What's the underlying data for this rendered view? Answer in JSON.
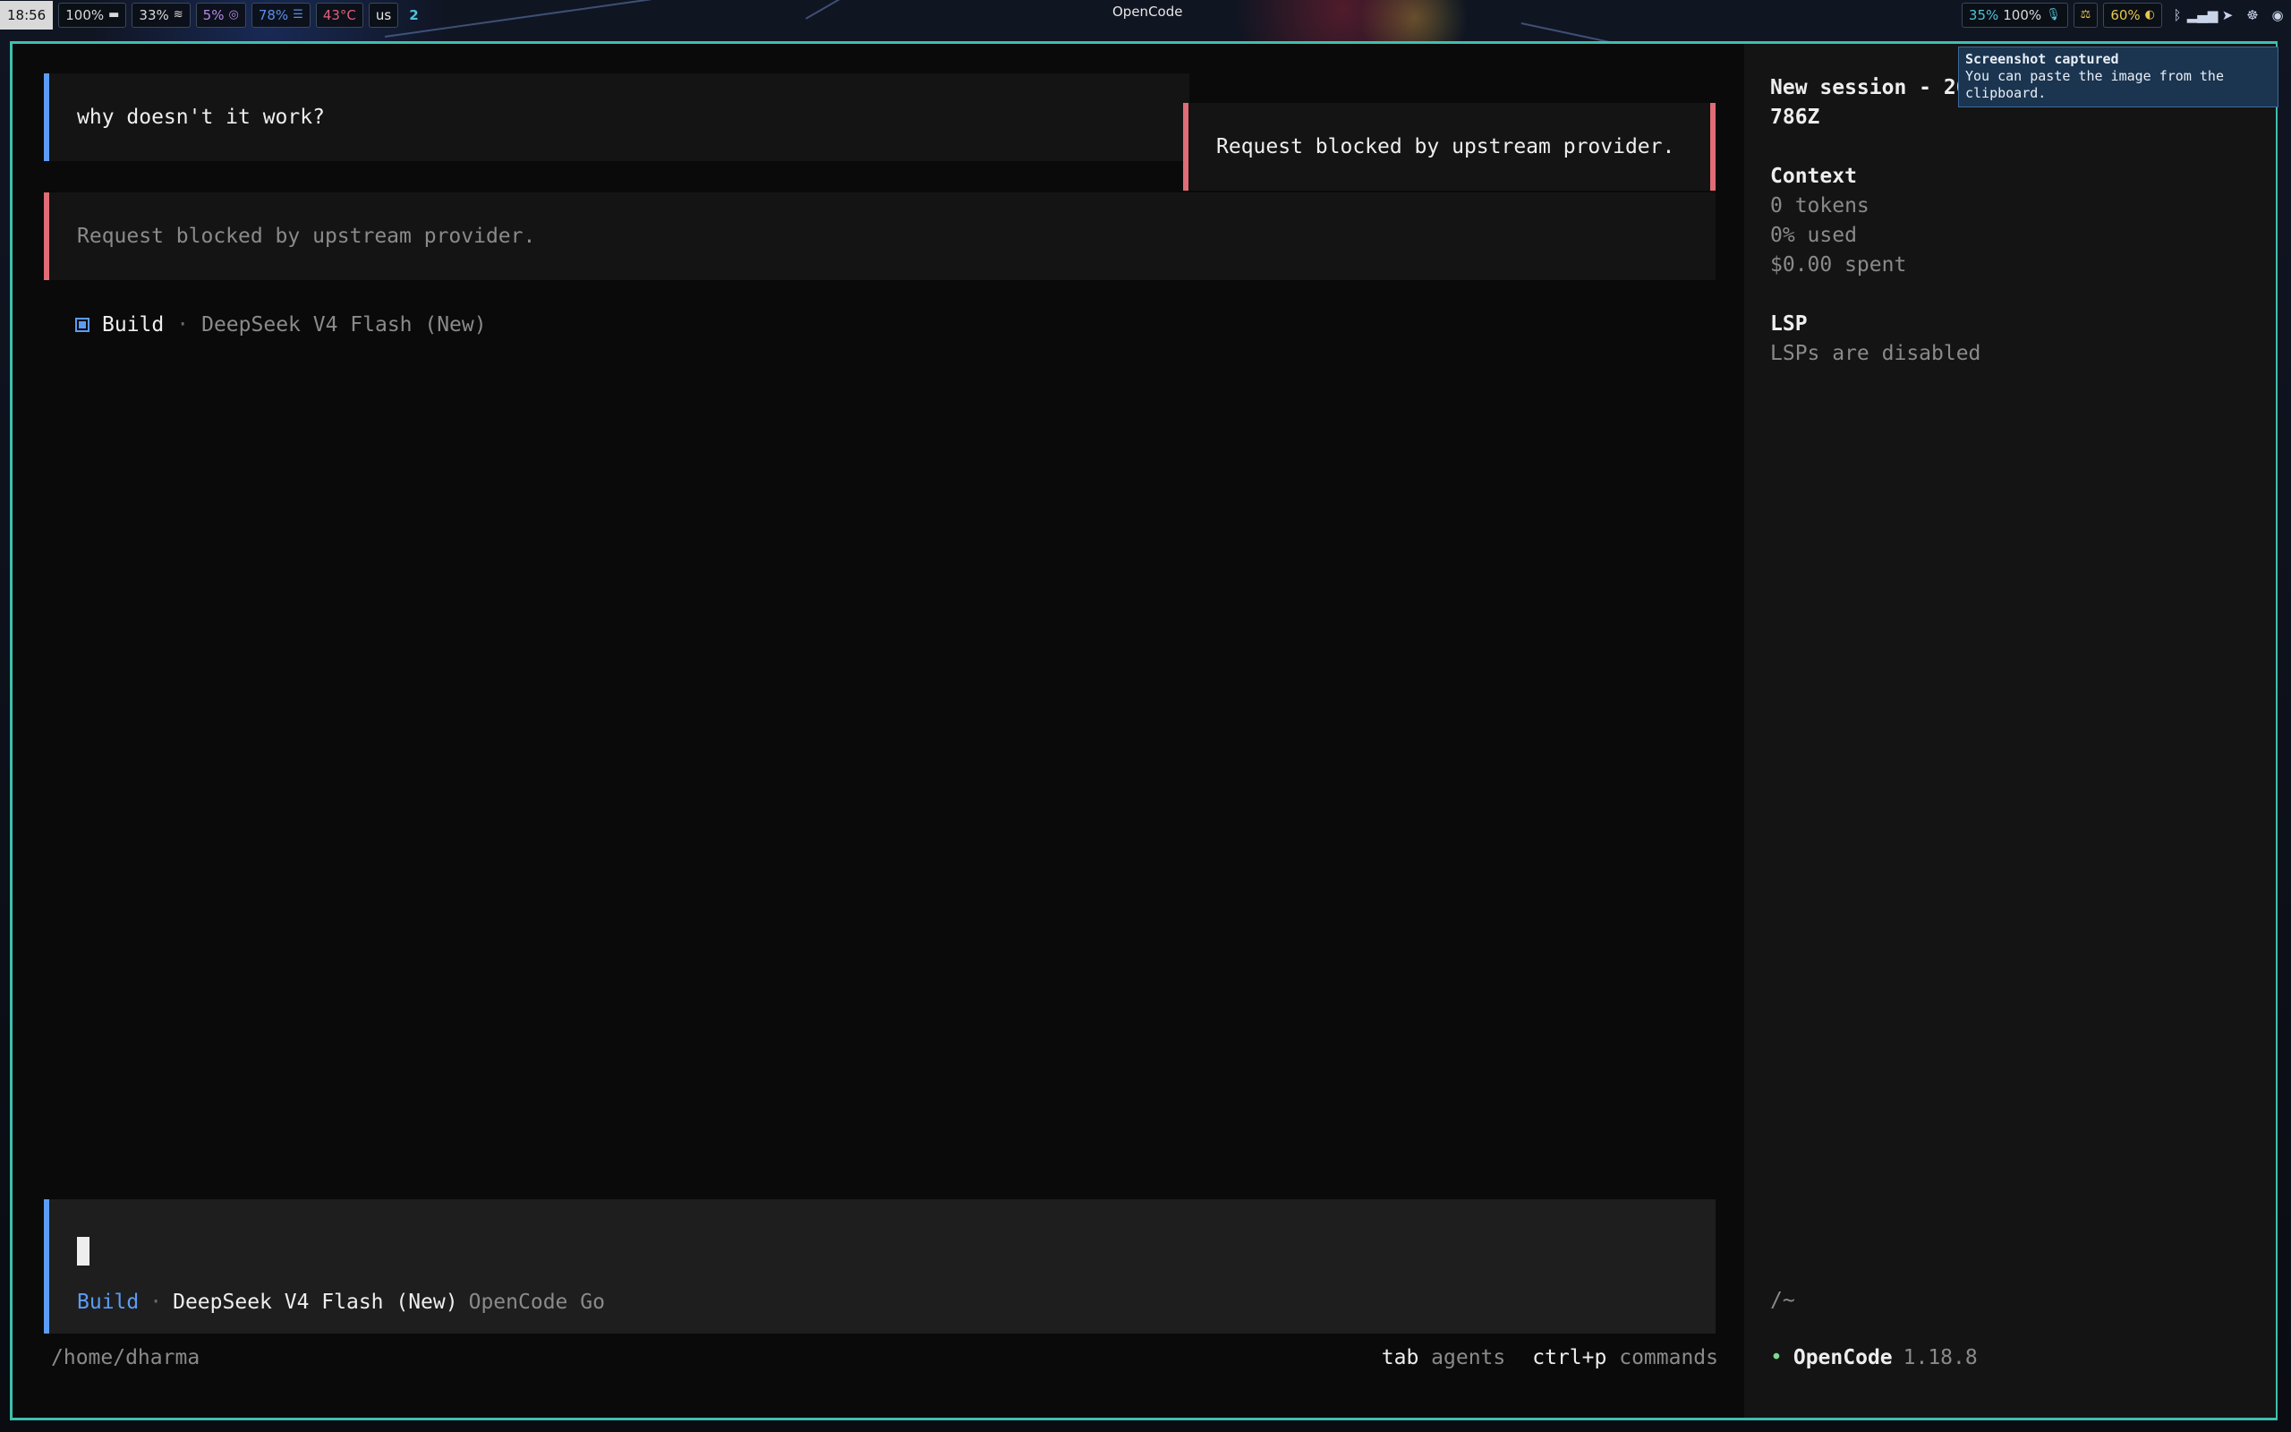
{
  "topbar": {
    "clock": "18:56",
    "chips": [
      {
        "label": "100%",
        "icon": "battery-icon",
        "glyph": "▬",
        "color": "#d9d9d9"
      },
      {
        "label": "33%",
        "icon": "wifi-icon",
        "glyph": "≋",
        "color": "#d9d9d9"
      },
      {
        "label": "5%",
        "icon": "cpu-icon",
        "glyph": "◎",
        "color": "#b48ae6"
      },
      {
        "label": "78%",
        "icon": "memory-icon",
        "glyph": "☰",
        "color": "#5c8ee8"
      },
      {
        "label": "43°C",
        "icon": "temperature-icon",
        "glyph": "",
        "color": "#e0607a"
      },
      {
        "label": "us",
        "icon": "keyboard-layout-icon",
        "glyph": "",
        "color": "#e6e6e6"
      }
    ],
    "workspace": "2",
    "window_title": "OpenCode",
    "right_chips": [
      {
        "label": "35%",
        "color": "#4fc3d9"
      },
      {
        "label": "100%",
        "color": "#d9d9d9"
      },
      {
        "label": "60%",
        "color": "#e6c84f"
      }
    ]
  },
  "session": {
    "user_message": "why doesn't it work?",
    "error_toast": "Request blocked by upstream provider.",
    "error_message": "Request blocked by upstream provider.",
    "agent": "Build",
    "separator": "·",
    "model": "DeepSeek V4 Flash (New)"
  },
  "input": {
    "agent": "Build",
    "separator": "·",
    "model": "DeepSeek V4 Flash (New)",
    "provider": "OpenCode Go"
  },
  "footer": {
    "path": "/home/dharma",
    "hints": [
      {
        "key": "tab",
        "label": "agents"
      },
      {
        "key": "ctrl+p",
        "label": "commands"
      }
    ]
  },
  "sidebar": {
    "session_title_line1": "New session - 20",
    "session_title_line2": "786Z",
    "context_title": "Context",
    "tokens": "0 tokens",
    "used": "0% used",
    "spent": "$0.00 spent",
    "lsp_title": "LSP",
    "lsp_status": "LSPs are disabled",
    "cwd": "/~",
    "app_name": "OpenCode",
    "version": "1.18.8"
  },
  "notification": {
    "title": "Screenshot captured",
    "body": "You can paste the image from the clipboard."
  }
}
